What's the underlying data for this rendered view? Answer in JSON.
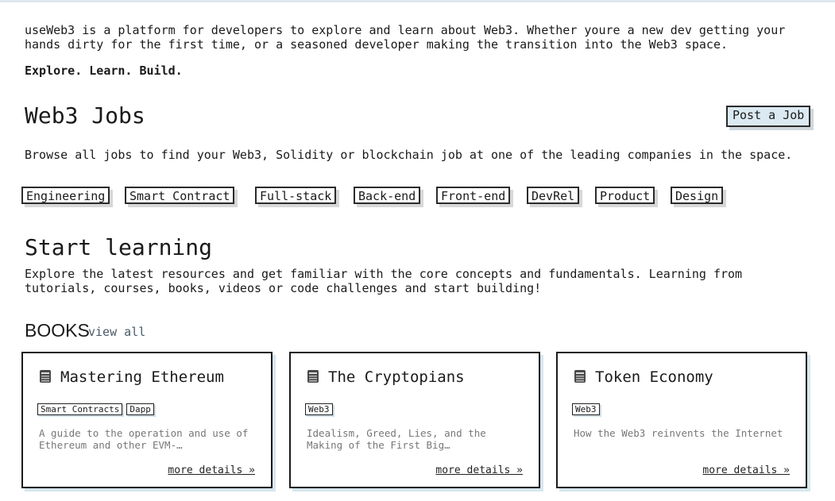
{
  "intro": {
    "text": "useWeb3 is a platform for developers to explore and learn about Web3. Whether youre a new dev getting your hands dirty for the first time, or a seasoned developer making the transition into the Web3 space.",
    "tagline": "Explore. Learn. Build."
  },
  "jobs": {
    "title": "Web3 Jobs",
    "post_button": "Post a Job",
    "description": "Browse all jobs to find your Web3, Solidity or blockchain job at one of the leading companies in the space.",
    "tags": [
      "Engineering",
      "Smart Contract",
      "Full-stack",
      "Back-end",
      "Front-end",
      "DevRel",
      "Product",
      "Design"
    ]
  },
  "learning": {
    "title": "Start learning",
    "description": "Explore the latest resources and get familiar with the core concepts and fundamentals. Learning from tutorials, courses, books, videos or code challenges and start building!"
  },
  "books": {
    "title": "BOOKS",
    "view_all": "view all",
    "icon": "book-icon",
    "more_label": "more details »",
    "items": [
      {
        "title": "Mastering Ethereum",
        "tags": [
          "Smart Contracts",
          "Dapp"
        ],
        "description": "A guide to the operation and use of Ethereum and other EVM-…"
      },
      {
        "title": "The Cryptopians",
        "tags": [
          "Web3"
        ],
        "description": "Idealism, Greed, Lies, and the Making of the First Big…"
      },
      {
        "title": "Token Economy",
        "tags": [
          "Web3"
        ],
        "description": "How the Web3 reinvents the Internet"
      }
    ]
  },
  "colors": {
    "accent_bg": "#dbe9f2",
    "shadow": "#d7e6ef",
    "muted_text": "#777777"
  }
}
